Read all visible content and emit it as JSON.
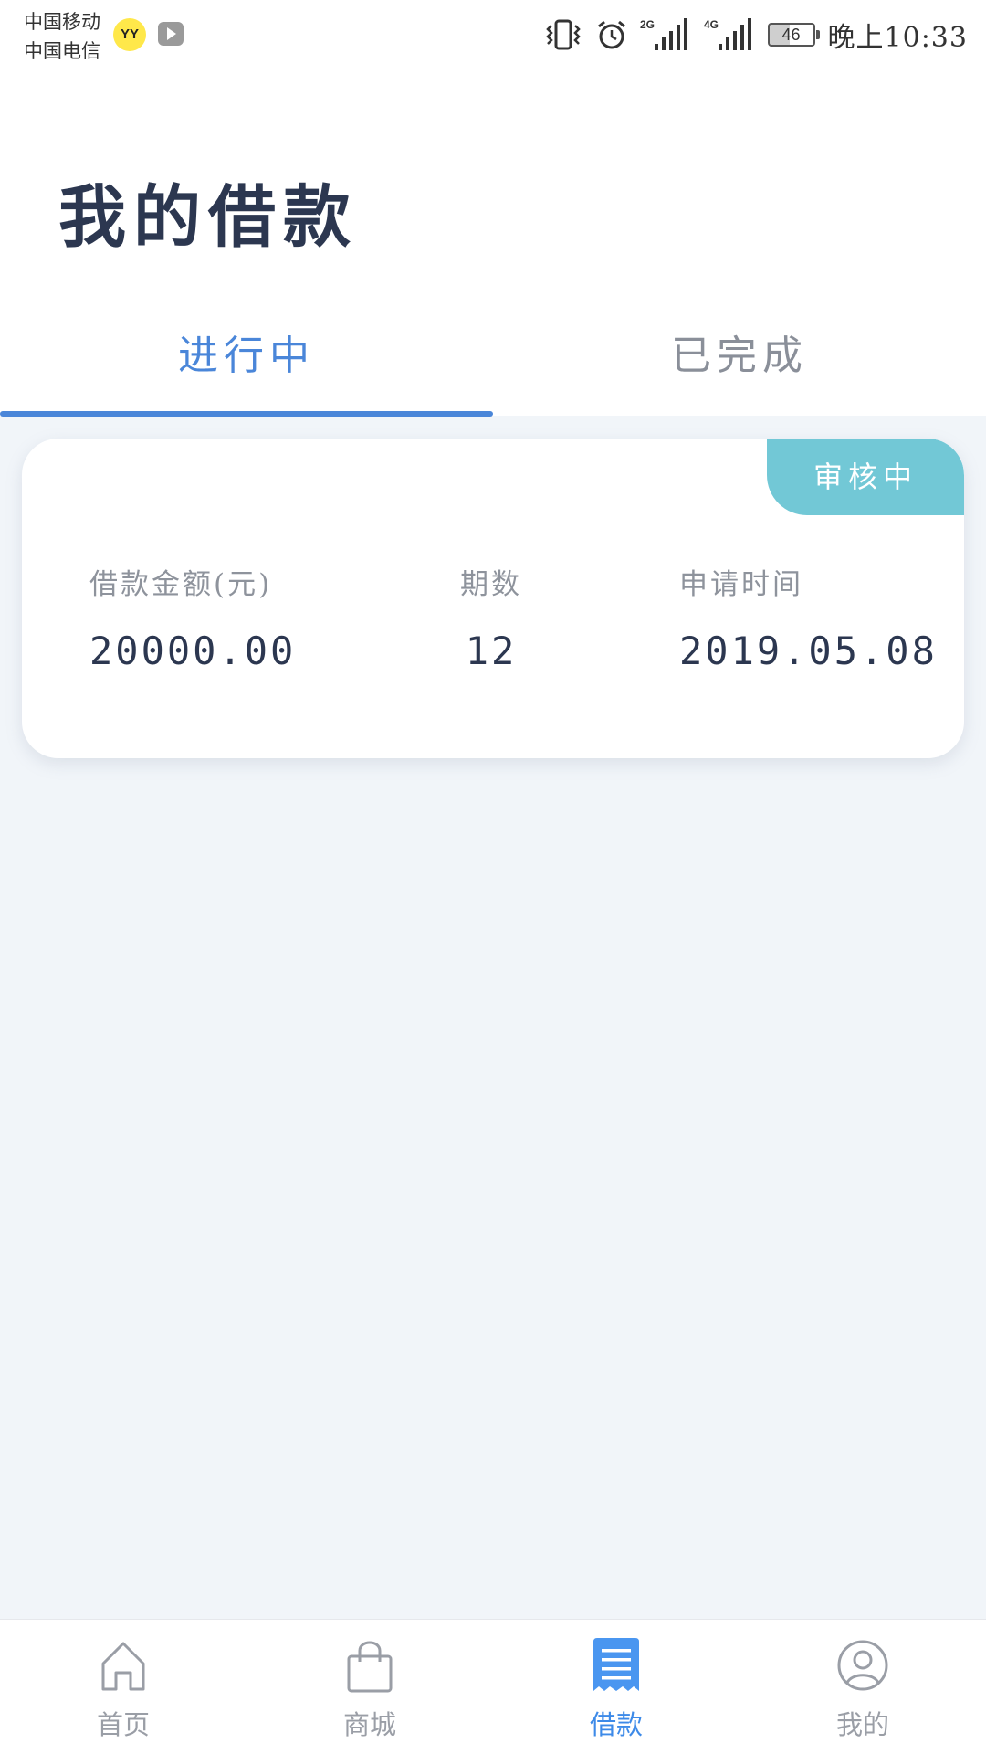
{
  "status_bar": {
    "carrier_1": "中国移动",
    "carrier_2": "中国电信",
    "yy_badge": "YY",
    "network_1": "2G",
    "network_2": "4G",
    "battery_level": "46",
    "time": "晚上10:33"
  },
  "header": {
    "title": "我的借款"
  },
  "tabs": [
    {
      "label": "进行中",
      "active": true
    },
    {
      "label": "已完成",
      "active": false
    }
  ],
  "loan_card": {
    "status": "审核中",
    "amount_label": "借款金额(元)",
    "amount_value": "20000.00",
    "periods_label": "期数",
    "periods_value": "12",
    "date_label": "申请时间",
    "date_value": "2019.05.08"
  },
  "bottom_nav": [
    {
      "label": "首页",
      "icon": "home-icon",
      "active": false
    },
    {
      "label": "商城",
      "icon": "shopping-bag-icon",
      "active": false
    },
    {
      "label": "借款",
      "icon": "loan-document-icon",
      "active": true
    },
    {
      "label": "我的",
      "icon": "user-profile-icon",
      "active": false
    }
  ],
  "colors": {
    "accent": "#4a86d9",
    "nav_active": "#3d8ae8",
    "badge": "#72c8d6",
    "title_text": "#2c3750",
    "background": "#f1f5f9"
  }
}
